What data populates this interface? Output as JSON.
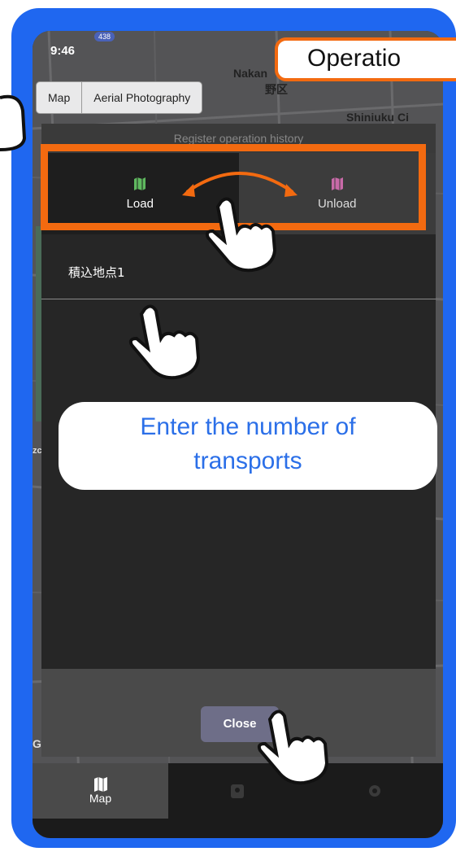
{
  "status_bar": {
    "time": "9:46",
    "route_badge": "438"
  },
  "map": {
    "labels": [
      "Nakan",
      "野区",
      "Shiniuku Ci",
      "zc",
      "G"
    ],
    "toggle": [
      "Map",
      "Aerial Photography"
    ]
  },
  "dialog": {
    "title": "Register operation history",
    "tabs": [
      {
        "label": "Load",
        "icon": "map-icon",
        "color": "#5fb85f",
        "selected": true
      },
      {
        "label": "Unload",
        "icon": "map-icon",
        "color": "#c86aa8",
        "selected": false
      }
    ],
    "list_item": "積込地点1",
    "close_label": "Close"
  },
  "tabbar": {
    "items": [
      {
        "label": "Map",
        "icon": "map-icon"
      },
      {
        "label": "",
        "icon": "badge-icon"
      },
      {
        "label": "",
        "icon": "gear-icon"
      }
    ]
  },
  "annotations": {
    "operation_callout": "Operatio",
    "enter_callout_line1": "Enter the number of",
    "enter_callout_line2": "transports",
    "accent": "#f36a10",
    "frame_color": "#1f67f0"
  }
}
